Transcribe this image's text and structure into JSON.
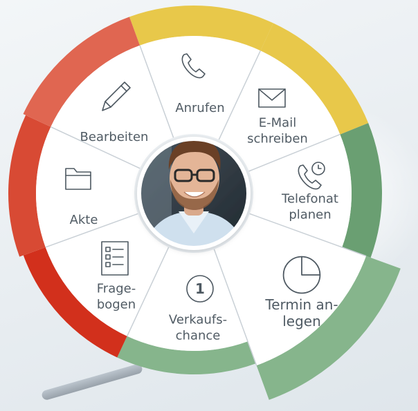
{
  "menu": {
    "center": {
      "avatar_alt": "Kontaktfoto"
    },
    "items": [
      {
        "id": "anrufen",
        "lines": [
          "Anrufen"
        ],
        "icon": "phone-icon",
        "ring_color": "#e8c84a"
      },
      {
        "id": "email",
        "lines": [
          "E-Mail",
          "schreiben"
        ],
        "icon": "mail-icon",
        "ring_color": "#e8c84a"
      },
      {
        "id": "telefonat",
        "lines": [
          "Telefonat",
          "planen"
        ],
        "icon": "phone-clock-icon",
        "ring_color": "#6a9f72"
      },
      {
        "id": "termin",
        "lines": [
          "Termin an-",
          "legen"
        ],
        "icon": "clock-pie-icon",
        "ring_color": "#86b58c"
      },
      {
        "id": "verkaufschance",
        "lines": [
          "Verkaufs-",
          "chance"
        ],
        "icon": "number-one-icon",
        "ring_color": "#86b58c"
      },
      {
        "id": "fragebogen",
        "lines": [
          "Frage-",
          "bogen"
        ],
        "icon": "checklist-icon",
        "ring_color": "#d2301c"
      },
      {
        "id": "akte",
        "lines": [
          "Akte"
        ],
        "icon": "folder-icon",
        "ring_color": "#d84a34"
      },
      {
        "id": "bearbeiten",
        "lines": [
          "Bearbeiten"
        ],
        "icon": "pencil-icon",
        "ring_color": "#e06651"
      }
    ],
    "number_badge": "1"
  }
}
